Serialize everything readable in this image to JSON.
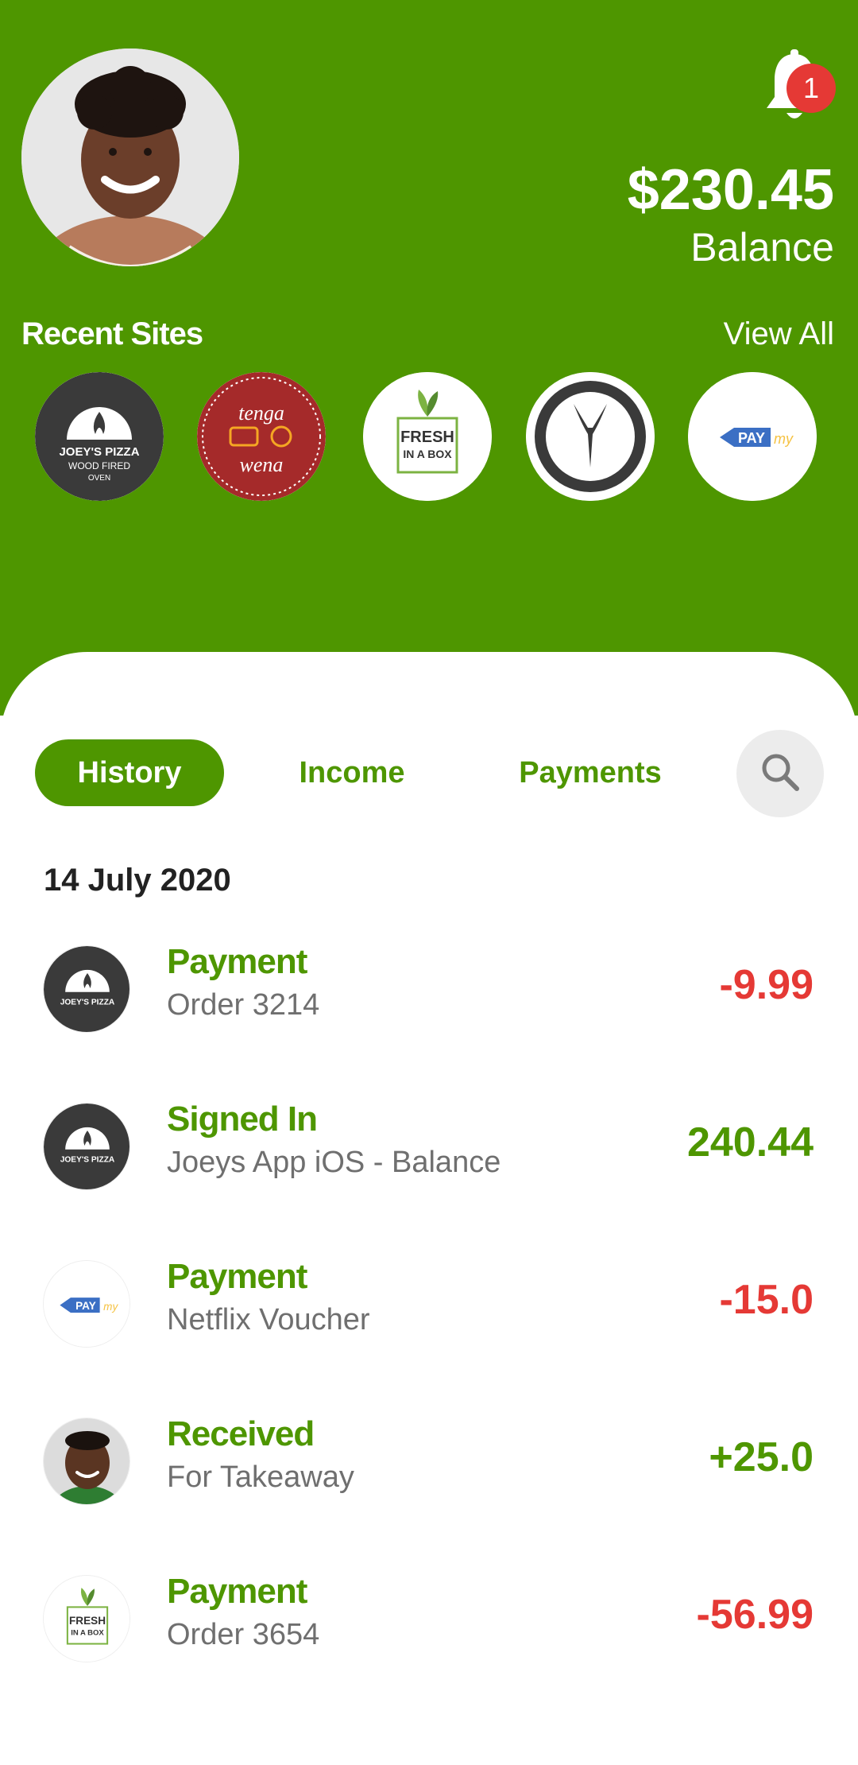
{
  "header": {
    "notifications": {
      "icon": "bell-icon",
      "badge_count": "1"
    },
    "balance": {
      "amount": "$230.45",
      "label": "Balance"
    },
    "recent_sites": {
      "title": "Recent Sites",
      "view_all": "View All",
      "sites": [
        {
          "name": "joeys-pizza-logo",
          "text1": "JOEY'S PIZZA",
          "text2": "WOOD FIRED",
          "text3": "OVEN"
        },
        {
          "name": "tenga-wena-logo",
          "text1": "tenga",
          "text2": "wena"
        },
        {
          "name": "fresh-in-a-box-logo",
          "text1": "FRESH",
          "text2": "IN A BOX"
        },
        {
          "name": "antelope-logo"
        },
        {
          "name": "paymy-logo",
          "text1": "PAY",
          "text2": "my"
        }
      ]
    }
  },
  "tabs": {
    "history": "History",
    "income": "Income",
    "payments": "Payments",
    "search_icon": "search-icon"
  },
  "history": {
    "date": "14 July 2020",
    "transactions": [
      {
        "title": "Payment",
        "subtitle": "Order 3214",
        "amount": "-9.99",
        "amount_color": "#e53935",
        "avatar": "joeys-pizza-logo"
      },
      {
        "title": "Signed In",
        "subtitle": "Joeys App iOS - Balance",
        "amount": "240.44",
        "amount_color": "#4e9600",
        "avatar": "joeys-pizza-logo"
      },
      {
        "title": "Payment",
        "subtitle": "Netflix Voucher",
        "amount": "-15.0",
        "amount_color": "#e53935",
        "avatar": "paymy-logo"
      },
      {
        "title": "Received",
        "subtitle": "For Takeaway",
        "amount": "+25.0",
        "amount_color": "#4e9600",
        "avatar": "person-photo"
      },
      {
        "title": "Payment",
        "subtitle": "Order 3654",
        "amount": "-56.99",
        "amount_color": "#e53935",
        "avatar": "fresh-in-a-box-logo"
      }
    ]
  },
  "colors": {
    "brand_green": "#4e9600",
    "negative_red": "#e53935",
    "badge_red": "#e53935"
  }
}
